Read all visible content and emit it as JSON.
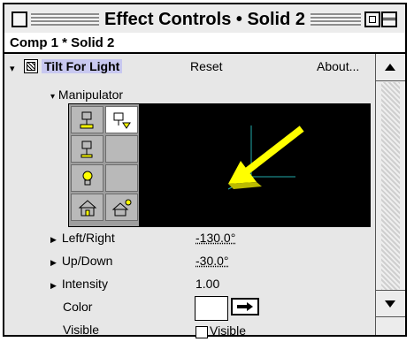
{
  "window": {
    "title": "Effect Controls • Solid 2"
  },
  "comp_header": "Comp 1 * Solid 2",
  "effect": {
    "name": "Tilt For Light",
    "reset_label": "Reset",
    "about_label": "About..."
  },
  "manipulator": {
    "label": "Manipulator"
  },
  "properties": {
    "left_right": {
      "label": "Left/Right",
      "value": "-130.0°"
    },
    "up_down": {
      "label": "Up/Down",
      "value": "-30.0°"
    },
    "intensity": {
      "label": "Intensity",
      "value": "1.00"
    },
    "color": {
      "label": "Color"
    },
    "visible": {
      "label": "Visible",
      "checkbox_label": "Visible",
      "checked": false
    }
  },
  "colors": {
    "arrow": "#ffff00",
    "axis": "#22aaaa",
    "viewport_bg": "#000000"
  }
}
